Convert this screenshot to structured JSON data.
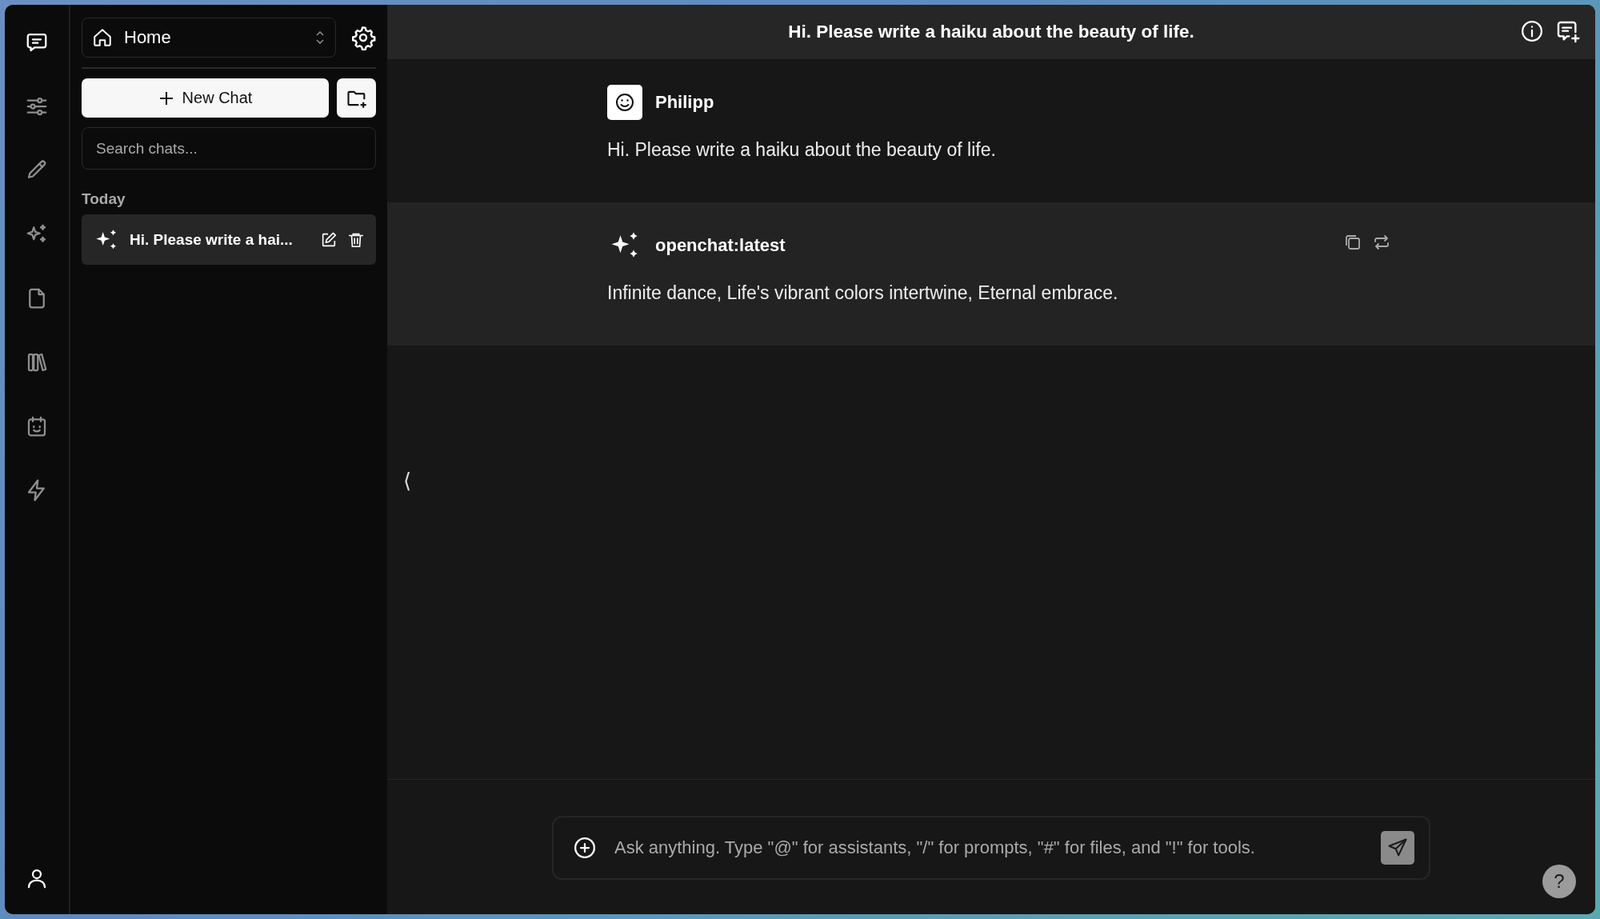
{
  "rail": {
    "items": [
      {
        "kind": "chat",
        "selected": true
      },
      {
        "kind": "sliders",
        "selected": false
      },
      {
        "kind": "pencil",
        "selected": false
      },
      {
        "kind": "sparkles",
        "selected": false
      },
      {
        "kind": "document",
        "selected": false
      },
      {
        "kind": "books",
        "selected": false
      },
      {
        "kind": "calendar",
        "selected": false
      },
      {
        "kind": "bolt",
        "selected": false
      }
    ]
  },
  "sidebar": {
    "workspace": "Home",
    "new_chat": "New Chat",
    "search": {
      "placeholder": "Search chats..."
    },
    "groups": [
      {
        "label": "Today",
        "chats": [
          {
            "title": "Hi. Please write a hai...",
            "selected": true
          }
        ]
      }
    ]
  },
  "header": {
    "title": "Hi. Please write a haiku about the beauty of life."
  },
  "messages": [
    {
      "kind": "user",
      "author": "Philipp",
      "text": "Hi. Please write a haiku about the beauty of life."
    },
    {
      "kind": "assistant",
      "author": "openchat:latest",
      "text": "Infinite dance, Life's vibrant colors intertwine, Eternal embrace."
    }
  ],
  "collapse_handle": "⟨",
  "composer": {
    "placeholder": "Ask anything. Type \"@\" for assistants, \"/\" for prompts, \"#\" for files, and \"!\" for tools."
  },
  "help": "?"
}
